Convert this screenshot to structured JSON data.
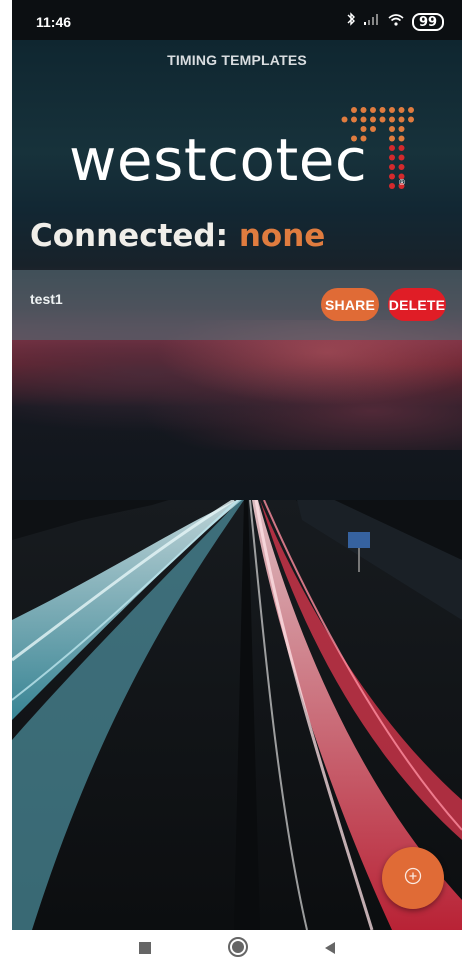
{
  "status_bar": {
    "time": "11:46",
    "battery": "99"
  },
  "header": {
    "title": "TIMING TEMPLATES"
  },
  "brand": {
    "logo_text": "westcotec",
    "registered_mark": "®",
    "accent_orange": "#e07c3f",
    "accent_red": "#d42a2d"
  },
  "connection": {
    "label": "Connected:",
    "value": "none"
  },
  "templates": [
    {
      "name": "test1",
      "share_label": "SHARE",
      "delete_label": "DELETE"
    }
  ],
  "colors": {
    "share_button": "#e06b36",
    "delete_button": "#e01d26",
    "fab": "#e06b36"
  },
  "icons": {
    "fab": "add-circle-icon",
    "nav_recent": "stop-square-icon",
    "nav_home": "home-circle-icon",
    "nav_back": "back-triangle-icon"
  }
}
